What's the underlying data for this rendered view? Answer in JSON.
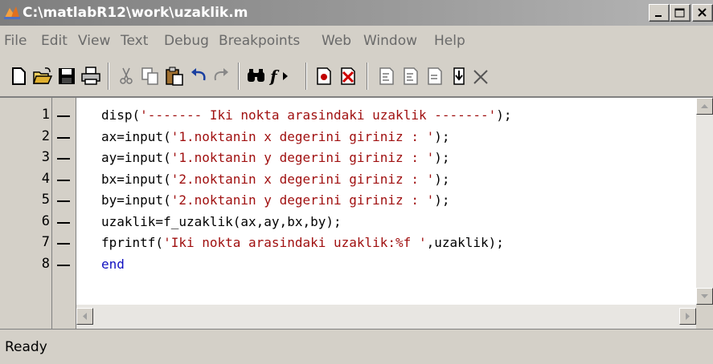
{
  "window": {
    "title": "C:\\matlabR12\\work\\uzaklik.m",
    "controls": [
      "minimize",
      "maximize",
      "close"
    ]
  },
  "menu": [
    "File",
    "Edit",
    "View",
    "Text",
    "Debug",
    "Breakpoints",
    "Web",
    "Window",
    "Help"
  ],
  "toolbar": {
    "icons": [
      "new-file-icon",
      "open-folder-icon",
      "save-icon",
      "print-icon",
      "cut-icon",
      "copy-icon",
      "paste-icon",
      "undo-icon",
      "redo-icon",
      "find-icon",
      "function-icon",
      "set-breakpoint-icon",
      "clear-breakpoints-icon",
      "step-icon",
      "step-in-icon",
      "step-out-icon",
      "continue-icon",
      "exit-debug-icon"
    ]
  },
  "editor": {
    "lines": [
      {
        "num": "1",
        "parts": [
          {
            "t": "disp(",
            "c": "n"
          },
          {
            "t": "'------- Iki nokta arasindaki uzaklik -------'",
            "c": "s"
          },
          {
            "t": ");",
            "c": "n"
          }
        ]
      },
      {
        "num": "2",
        "parts": [
          {
            "t": "ax=input(",
            "c": "n"
          },
          {
            "t": "'1.noktanin x degerini giriniz : '",
            "c": "s"
          },
          {
            "t": ");",
            "c": "n"
          }
        ]
      },
      {
        "num": "3",
        "parts": [
          {
            "t": "ay=input(",
            "c": "n"
          },
          {
            "t": "'1.noktanin y degerini giriniz : '",
            "c": "s"
          },
          {
            "t": ");",
            "c": "n"
          }
        ]
      },
      {
        "num": "4",
        "parts": [
          {
            "t": "bx=input(",
            "c": "n"
          },
          {
            "t": "'2.noktanin x degerini giriniz : '",
            "c": "s"
          },
          {
            "t": ");",
            "c": "n"
          }
        ]
      },
      {
        "num": "5",
        "parts": [
          {
            "t": "by=input(",
            "c": "n"
          },
          {
            "t": "'2.noktanin y degerini giriniz : '",
            "c": "s"
          },
          {
            "t": ");",
            "c": "n"
          }
        ]
      },
      {
        "num": "6",
        "parts": [
          {
            "t": "uzaklik=f_uzaklik(ax,ay,bx,by);",
            "c": "n"
          }
        ]
      },
      {
        "num": "7",
        "parts": [
          {
            "t": "fprintf(",
            "c": "n"
          },
          {
            "t": "'Iki nokta arasindaki uzaklik:%f '",
            "c": "s"
          },
          {
            "t": ",uzaklik);",
            "c": "n"
          }
        ]
      },
      {
        "num": "8",
        "parts": [
          {
            "t": "end",
            "c": "k"
          }
        ]
      }
    ]
  },
  "status": {
    "text": "Ready"
  },
  "colors": {
    "string": "#a01010",
    "keyword": "#1010c0"
  }
}
